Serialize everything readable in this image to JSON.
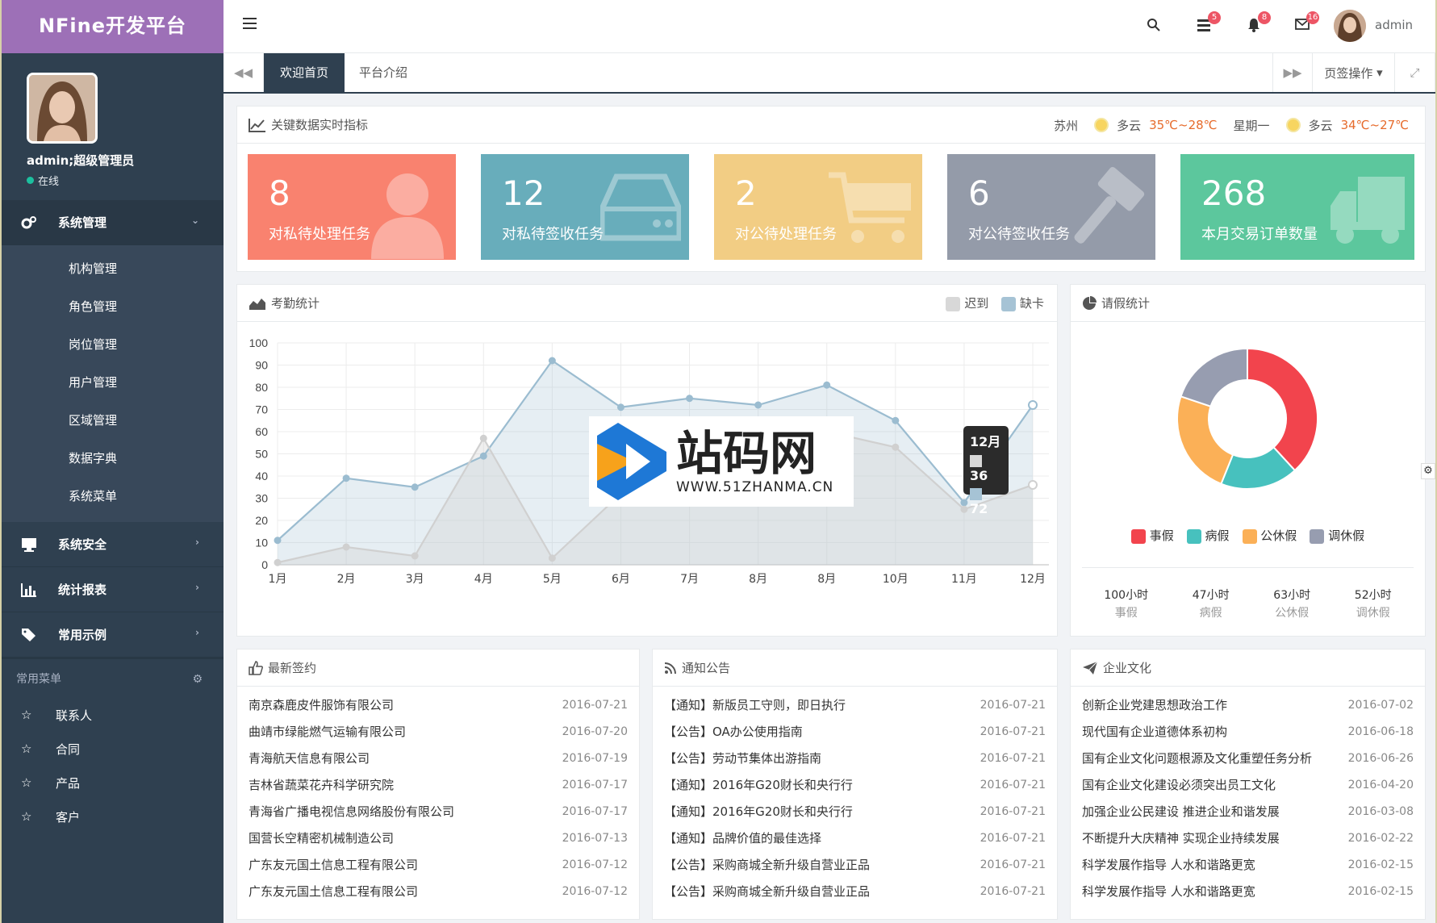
{
  "app": {
    "logo": "NFine开发平台"
  },
  "user": {
    "name": "admin;超级管理员",
    "status": "在线",
    "top_name": "admin"
  },
  "sidebar": {
    "groups": [
      {
        "label": "系统管理",
        "icon": "cogs-icon",
        "expanded": true,
        "items": [
          "机构管理",
          "角色管理",
          "岗位管理",
          "用户管理",
          "区域管理",
          "数据字典",
          "系统菜单"
        ]
      },
      {
        "label": "系统安全",
        "icon": "desktop-icon"
      },
      {
        "label": "统计报表",
        "icon": "bar-chart-icon"
      },
      {
        "label": "常用示例",
        "icon": "tags-icon"
      }
    ],
    "common_menu_title": "常用菜单",
    "favorites": [
      "联系人",
      "合同",
      "产品",
      "客户"
    ]
  },
  "topbar": {
    "badges": {
      "tasks": "5",
      "alerts": "8",
      "messages": "16"
    }
  },
  "tabs": {
    "items": [
      "欢迎首页",
      "平台介绍"
    ],
    "active": 0,
    "ops_label": "页签操作"
  },
  "kpi": {
    "title": "关键数据实时指标",
    "weather": {
      "city": "苏州",
      "w1": "多云",
      "t1": "35℃~28℃",
      "day": "星期一",
      "w2": "多云",
      "t2": "34℃~27℃"
    },
    "cards": [
      {
        "value": "8",
        "label": "对私待处理任务",
        "color": "#f9826f",
        "icon": "user-icon"
      },
      {
        "value": "12",
        "label": "对私待签收任务",
        "color": "#68adbb",
        "icon": "hdd-icon"
      },
      {
        "value": "2",
        "label": "对公待处理任务",
        "color": "#f2cd84",
        "icon": "cart-icon"
      },
      {
        "value": "6",
        "label": "对公待签收任务",
        "color": "#949ba9",
        "icon": "gavel-icon"
      },
      {
        "value": "268",
        "label": "本月交易订单数量",
        "color": "#5cc79d",
        "icon": "truck-icon"
      }
    ]
  },
  "attendance": {
    "title": "考勤统计",
    "legend": [
      "迟到",
      "缺卡"
    ]
  },
  "tooltip": {
    "title": "12月",
    "v1": "36",
    "v2": "72"
  },
  "watermark": {
    "brand": "站码网",
    "url": "WWW.51ZHANMA.CN"
  },
  "leave": {
    "title": "请假统计",
    "legend": [
      "事假",
      "病假",
      "公休假",
      "调休假"
    ],
    "stats": [
      {
        "value": "100小时",
        "label": "事假"
      },
      {
        "value": "47小时",
        "label": "病假"
      },
      {
        "value": "63小时",
        "label": "公休假"
      },
      {
        "value": "52小时",
        "label": "调休假"
      }
    ]
  },
  "chart_data": [
    {
      "type": "area",
      "categories": [
        "1月",
        "2月",
        "3月",
        "4月",
        "5月",
        "6月",
        "7月",
        "8月",
        "8月",
        "10月",
        "11月",
        "12月"
      ],
      "series": [
        {
          "name": "迟到",
          "values": [
            1,
            8,
            4,
            57,
            3,
            32,
            45,
            55,
            60,
            53,
            25,
            36
          ],
          "color": "#d0d0d0"
        },
        {
          "name": "缺卡",
          "values": [
            11,
            39,
            35,
            49,
            92,
            71,
            75,
            72,
            81,
            65,
            28,
            72
          ],
          "color": "#9bbcd0"
        }
      ],
      "ylim": [
        0,
        100
      ],
      "yticks": [
        0,
        10,
        20,
        30,
        40,
        50,
        60,
        70,
        80,
        90,
        100
      ],
      "grid": true,
      "legend": "top-right"
    },
    {
      "type": "pie",
      "categories": [
        "事假",
        "病假",
        "公休假",
        "调休假"
      ],
      "values": [
        100,
        47,
        63,
        52
      ],
      "colors": [
        "#f2444d",
        "#47c1be",
        "#fbb057",
        "#979db0"
      ],
      "donut": true,
      "legend": "bottom"
    }
  ],
  "contracts": {
    "title": "最新签约",
    "rows": [
      {
        "name": "南京森鹿皮件服饰有限公司",
        "date": "2016-07-21"
      },
      {
        "name": "曲靖市绿能燃气运输有限公司",
        "date": "2016-07-20"
      },
      {
        "name": "青海航天信息有限公司",
        "date": "2016-07-19"
      },
      {
        "name": "吉林省蔬菜花卉科学研究院",
        "date": "2016-07-17"
      },
      {
        "name": "青海省广播电视信息网络股份有限公司",
        "date": "2016-07-17"
      },
      {
        "name": "国营长空精密机械制造公司",
        "date": "2016-07-13"
      },
      {
        "name": "广东友元国土信息工程有限公司",
        "date": "2016-07-12"
      },
      {
        "name": "广东友元国土信息工程有限公司",
        "date": "2016-07-12"
      }
    ]
  },
  "notices": {
    "title": "通知公告",
    "rows": [
      {
        "name": "【通知】新版员工守则，即日执行",
        "date": "2016-07-21"
      },
      {
        "name": "【公告】OA办公使用指南",
        "date": "2016-07-21"
      },
      {
        "name": "【公告】劳动节集体出游指南",
        "date": "2016-07-21"
      },
      {
        "name": "【通知】2016年G20财长和央行行",
        "date": "2016-07-21"
      },
      {
        "name": "【通知】2016年G20财长和央行行",
        "date": "2016-07-21"
      },
      {
        "name": "【通知】品牌价值的最佳选择",
        "date": "2016-07-21"
      },
      {
        "name": "【公告】采购商城全新升级自营业正品",
        "date": "2016-07-21"
      },
      {
        "name": "【公告】采购商城全新升级自营业正品",
        "date": "2016-07-21"
      }
    ]
  },
  "culture": {
    "title": "企业文化",
    "rows": [
      {
        "name": "创新企业党建思想政治工作",
        "date": "2016-07-02"
      },
      {
        "name": "现代国有企业道德体系初构",
        "date": "2016-06-18"
      },
      {
        "name": "国有企业文化问题根源及文化重塑任务分析",
        "date": "2016-06-26"
      },
      {
        "name": "国有企业文化建设必须突出员工文化",
        "date": "2016-04-20"
      },
      {
        "name": "加强企业公民建设 推进企业和谐发展",
        "date": "2016-03-08"
      },
      {
        "name": "不断提升大庆精神 实现企业持续发展",
        "date": "2016-02-22"
      },
      {
        "name": "科学发展作指导 人水和谐路更宽",
        "date": "2016-02-15"
      },
      {
        "name": "科学发展作指导 人水和谐路更宽",
        "date": "2016-02-15"
      }
    ]
  }
}
